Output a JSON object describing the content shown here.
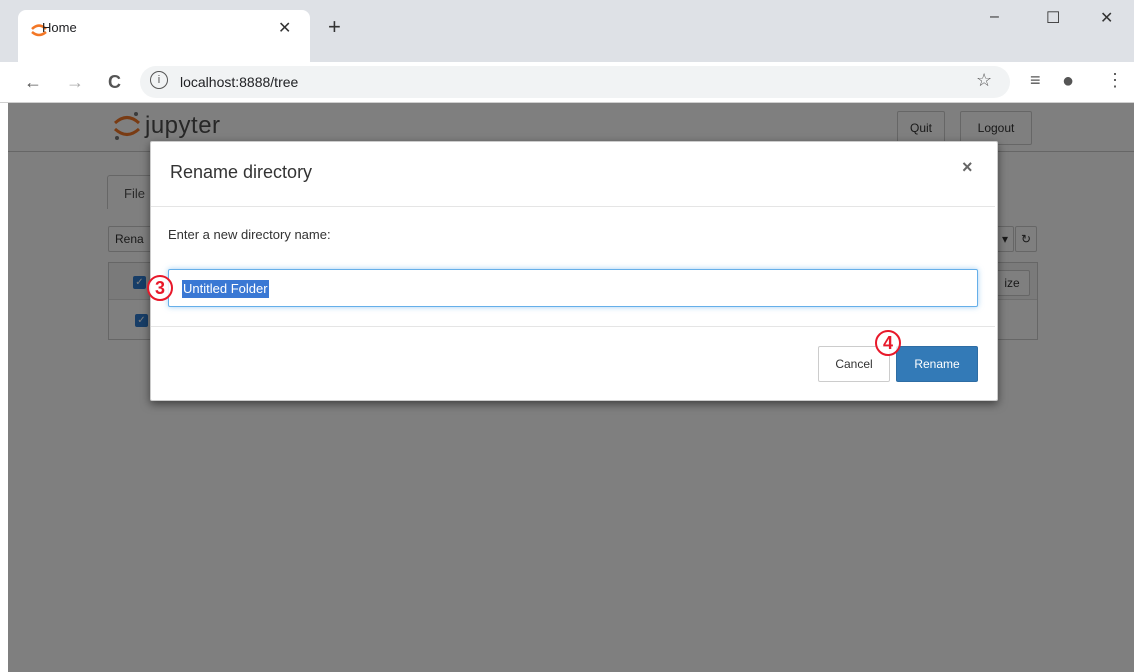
{
  "browser": {
    "tab_title": "Home",
    "tab_close": "✕",
    "new_tab": "+",
    "url": "localhost:8888/tree",
    "url_info": "i",
    "window_controls": {
      "minimize": "–",
      "maximize": "☐",
      "close": "✕"
    },
    "nav": {
      "back": "←",
      "forward": "→",
      "reload": "C"
    },
    "toolbar_icons": {
      "star": "☆",
      "media": "≡",
      "account": "●",
      "menu": "⋮"
    }
  },
  "jupyter": {
    "logo_text": "jupyter",
    "quit_label": "Quit",
    "logout_label": "Logout",
    "files_tab": "File",
    "toolbar_rename": "Rena",
    "size_label": "ize",
    "dropdown_glyph": "▾",
    "refresh_glyph": "↻",
    "checkmark": "✓"
  },
  "dialog": {
    "title": "Rename directory",
    "close": "×",
    "label": "Enter a new directory name:",
    "input_value": "Untitled Folder",
    "cancel_label": "Cancel",
    "rename_label": "Rename"
  },
  "annotations": {
    "step3": "3",
    "step4": "4",
    "color": "#e8182a"
  }
}
